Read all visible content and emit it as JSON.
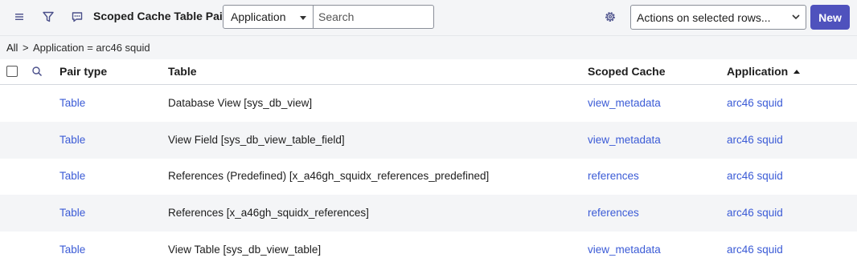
{
  "header": {
    "title": "Scoped Cache Table Pairs",
    "field_select": "Application",
    "search_placeholder": "Search",
    "actions_select": "Actions on selected rows...",
    "new_label": "New",
    "accent_color": "#4f52bd",
    "icons": [
      "menu-icon",
      "filter-icon",
      "comment-icon",
      "gear-icon"
    ]
  },
  "breadcrumb": {
    "root": "All",
    "separator": ">",
    "condition": "Application = arc46 squid"
  },
  "table": {
    "columns": [
      "Pair type",
      "Table",
      "Scoped Cache",
      "Application"
    ],
    "sorted_column": "Application",
    "sort_direction": "ascending",
    "rows": [
      {
        "pair_type": "Table",
        "table": "Database View [sys_db_view]",
        "scoped_cache": "view_metadata",
        "application": "arc46 squid"
      },
      {
        "pair_type": "Table",
        "table": "View Field [sys_db_view_table_field]",
        "scoped_cache": "view_metadata",
        "application": "arc46 squid"
      },
      {
        "pair_type": "Table",
        "table": "References (Predefined) [x_a46gh_squidx_references_predefined]",
        "scoped_cache": "references",
        "application": "arc46 squid"
      },
      {
        "pair_type": "Table",
        "table": "References [x_a46gh_squidx_references]",
        "scoped_cache": "references",
        "application": "arc46 squid"
      },
      {
        "pair_type": "Table",
        "table": "View Table [sys_db_view_table]",
        "scoped_cache": "view_metadata",
        "application": "arc46 squid"
      }
    ]
  }
}
